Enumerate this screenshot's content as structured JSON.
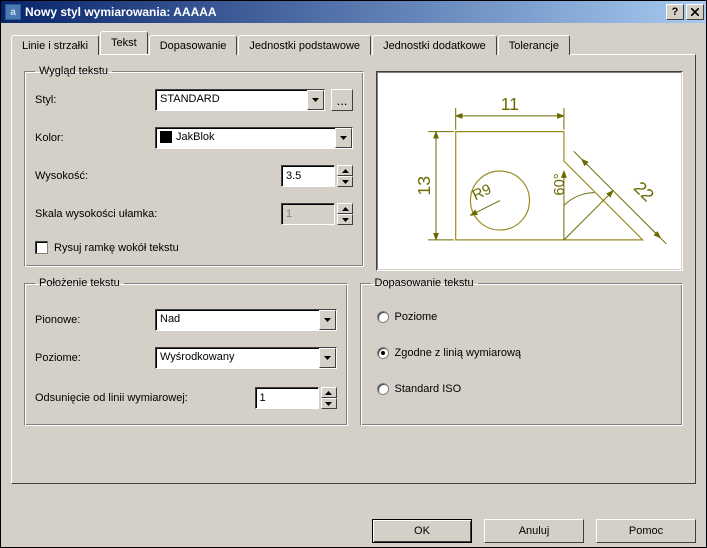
{
  "window": {
    "title": "Nowy styl wymiarowania: AAAAA"
  },
  "tabs": {
    "t0": "Linie i strzałki",
    "t1": "Tekst",
    "t2": "Dopasowanie",
    "t3": "Jednostki podstawowe",
    "t4": "Jednostki dodatkowe",
    "t5": "Tolerancje"
  },
  "appearance": {
    "legend": "Wygląd tekstu",
    "style_label": "Styl:",
    "style_value": "STANDARD",
    "color_label": "Kolor:",
    "color_value": "JakBlok",
    "height_label": "Wysokość:",
    "height_value": "3.5",
    "fraction_label": "Skala wysokości ułamka:",
    "fraction_value": "1",
    "frame_label": "Rysuj ramkę wokół tekstu"
  },
  "placement": {
    "legend": "Położenie tekstu",
    "vertical_label": "Pionowe:",
    "vertical_value": "Nad",
    "horizontal_label": "Poziome:",
    "horizontal_value": "Wyśrodkowany",
    "offset_label": "Odsunięcie od linii wymiarowej:",
    "offset_value": "1"
  },
  "fit": {
    "legend": "Dopasowanie tekstu",
    "opt_horizontal": "Poziome",
    "opt_aligned": "Zgodne z linią wymiarową",
    "opt_iso": "Standard ISO"
  },
  "preview": {
    "d_top": "11",
    "d_left": "13",
    "d_radius": "R9",
    "d_angle": "60°",
    "d_diag": "22"
  },
  "buttons": {
    "ok": "OK",
    "cancel": "Anuluj",
    "help": "Pomoc"
  }
}
